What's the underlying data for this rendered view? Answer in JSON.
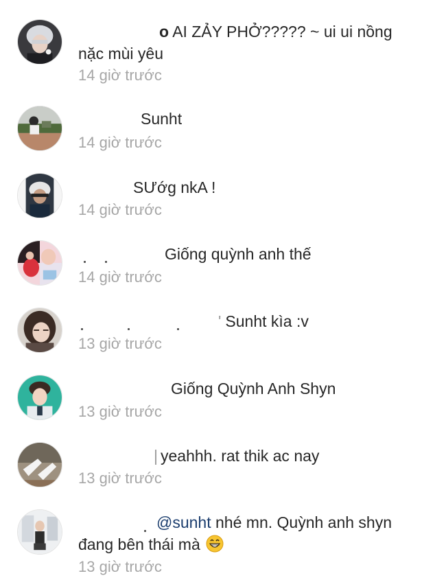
{
  "comments": [
    {
      "username_tail": "o",
      "text": "AI ZẢY PHỞ????? ~ ui ui nồng",
      "text2": "nặc mùi yêu",
      "time": "14 giờ trước",
      "avatar": "avatar-silver-hair-icon"
    },
    {
      "text": "Sunht",
      "time": "14 giờ trước",
      "avatar": "avatar-street-icon"
    },
    {
      "text": "SƯớg nkA !",
      "time": "14 giờ trước",
      "avatar": "avatar-helmet-icon"
    },
    {
      "text": "Giống quỳnh anh thế",
      "time": "14 giờ trước",
      "avatar": "avatar-collage-icon"
    },
    {
      "text": "Sunht kìa :v",
      "time": "13 giờ trước",
      "avatar": "avatar-girl-icon"
    },
    {
      "text": "Giống Quỳnh Anh Shyn",
      "time": "13 giờ trước",
      "avatar": "avatar-man-icon"
    },
    {
      "text": "yeahhh. rat thik ac nay",
      "time": "13 giờ trước",
      "avatar": "avatar-shoes-icon"
    },
    {
      "mention": "@sunht",
      "text": "nhé mn. Quỳnh anh shyn",
      "text2": "đang bên thái mà",
      "emoji": "grinning-face-icon",
      "time": "13 giờ trước",
      "avatar": "avatar-room-icon"
    }
  ]
}
